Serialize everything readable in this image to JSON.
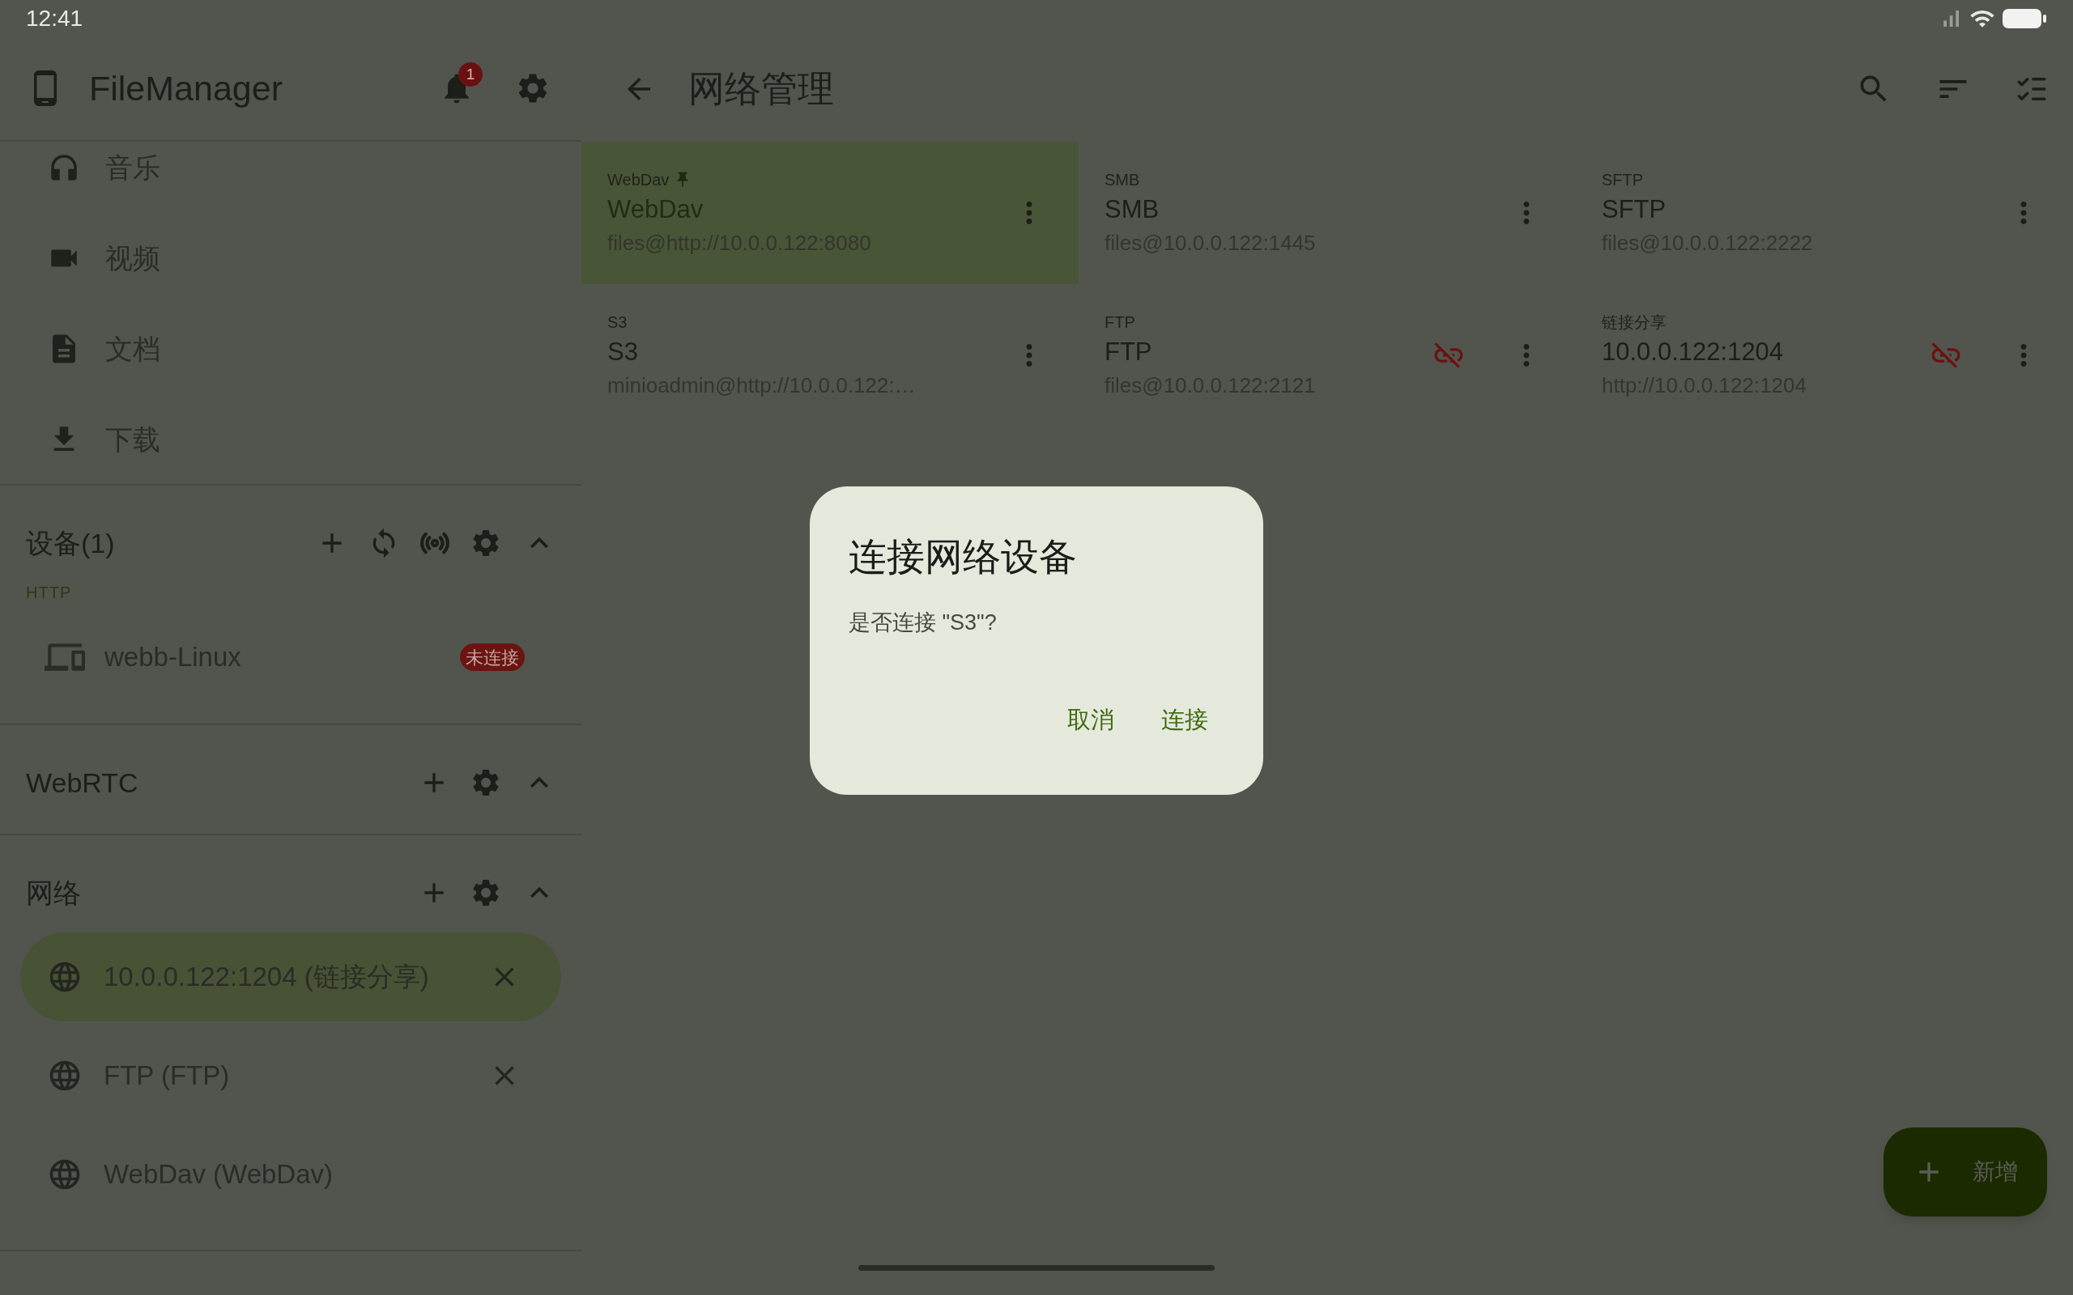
{
  "status_bar": {
    "time": "12:41"
  },
  "drawer": {
    "title": "FileManager",
    "notification_count": "1",
    "items": [
      {
        "label": "音乐"
      },
      {
        "label": "视频"
      },
      {
        "label": "文档"
      },
      {
        "label": "下载"
      }
    ],
    "sections": [
      {
        "kind": "devices",
        "title": "设备(1)",
        "expanded": true,
        "groups": [
          {
            "label": "HTTP",
            "devices": [
              {
                "name": "webb-Linux",
                "status": "未连接"
              }
            ]
          }
        ]
      },
      {
        "kind": "webrtc",
        "title": "WebRTC",
        "expanded": true
      },
      {
        "kind": "network",
        "title": "网络",
        "expanded": true,
        "items": [
          {
            "label": "10.0.0.122:1204 (链接分享)",
            "selected": true,
            "closable": true
          },
          {
            "label": "FTP (FTP)",
            "selected": false,
            "closable": true
          },
          {
            "label": "WebDav (WebDav)",
            "selected": false,
            "closable": false
          }
        ]
      }
    ]
  },
  "main": {
    "title": "网络管理",
    "cards": [
      {
        "type": "WebDav",
        "name": "WebDav",
        "address": "files@http://10.0.0.122:8080",
        "selected": true,
        "pinned": true,
        "disconnected": false
      },
      {
        "type": "SMB",
        "name": "SMB",
        "address": "files@10.0.0.122:1445",
        "selected": false,
        "pinned": false,
        "disconnected": false
      },
      {
        "type": "SFTP",
        "name": "SFTP",
        "address": "files@10.0.0.122:2222",
        "selected": false,
        "pinned": false,
        "disconnected": false
      },
      {
        "type": "S3",
        "name": "S3",
        "address": "minioadmin@http://10.0.0.122:…",
        "selected": false,
        "pinned": false,
        "disconnected": false
      },
      {
        "type": "FTP",
        "name": "FTP",
        "address": "files@10.0.0.122:2121",
        "selected": false,
        "pinned": false,
        "disconnected": true
      },
      {
        "type": "链接分享",
        "name": "10.0.0.122:1204",
        "address": "http://10.0.0.122:1204",
        "selected": false,
        "pinned": false,
        "disconnected": true
      }
    ]
  },
  "dialog": {
    "title": "连接网络设备",
    "message": "是否连接 \"S3\"?",
    "buttons": [
      "取消",
      "连接"
    ]
  },
  "fab": {
    "label": "新增"
  }
}
